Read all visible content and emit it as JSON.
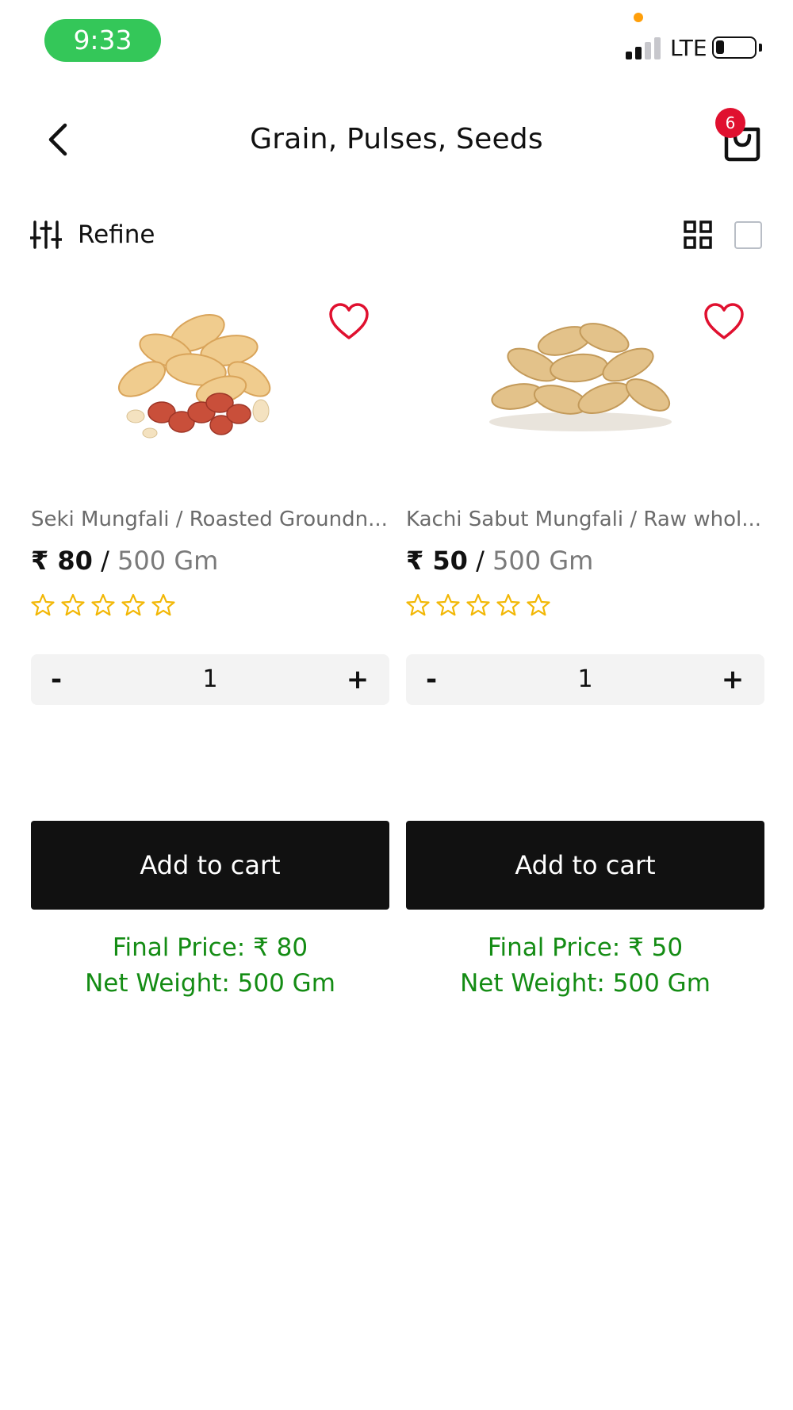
{
  "status_bar": {
    "time": "9:33",
    "network": "LTE"
  },
  "header": {
    "title": "Grain, Pulses, Seeds",
    "cart_count": "6"
  },
  "toolbar": {
    "refine_label": "Refine"
  },
  "products": [
    {
      "name": "Seki Mungfali / Roasted Groundn...",
      "price": "₹ 80",
      "separator": "/",
      "unit": "500 Gm",
      "rating": 0,
      "quantity": "1",
      "add_to_cart_label": "Add to cart",
      "final_price": "Final Price: ₹ 80",
      "net_weight": "Net Weight: 500 Gm"
    },
    {
      "name": "Kachi Sabut Mungfali / Raw whol...",
      "price": "₹ 50",
      "separator": "/",
      "unit": "500 Gm",
      "rating": 0,
      "quantity": "1",
      "add_to_cart_label": "Add to cart",
      "final_price": "Final Price: ₹ 50",
      "net_weight": "Net Weight: 500 Gm"
    }
  ],
  "stepper": {
    "minus_label": "-",
    "plus_label": "+"
  },
  "icons": {
    "back": "chevron-left-icon",
    "cart": "shopping-bag-icon",
    "refine": "sliders-icon",
    "grid_view": "grid-icon",
    "list_view": "square-icon",
    "wishlist": "heart-icon",
    "rating": "star-outline-icon"
  },
  "colors": {
    "accent_green": "#148c14",
    "time_pill": "#34c759",
    "badge": "#e0102f",
    "heart": "#e0102f",
    "star": "#f2b705",
    "button": "#111111"
  }
}
